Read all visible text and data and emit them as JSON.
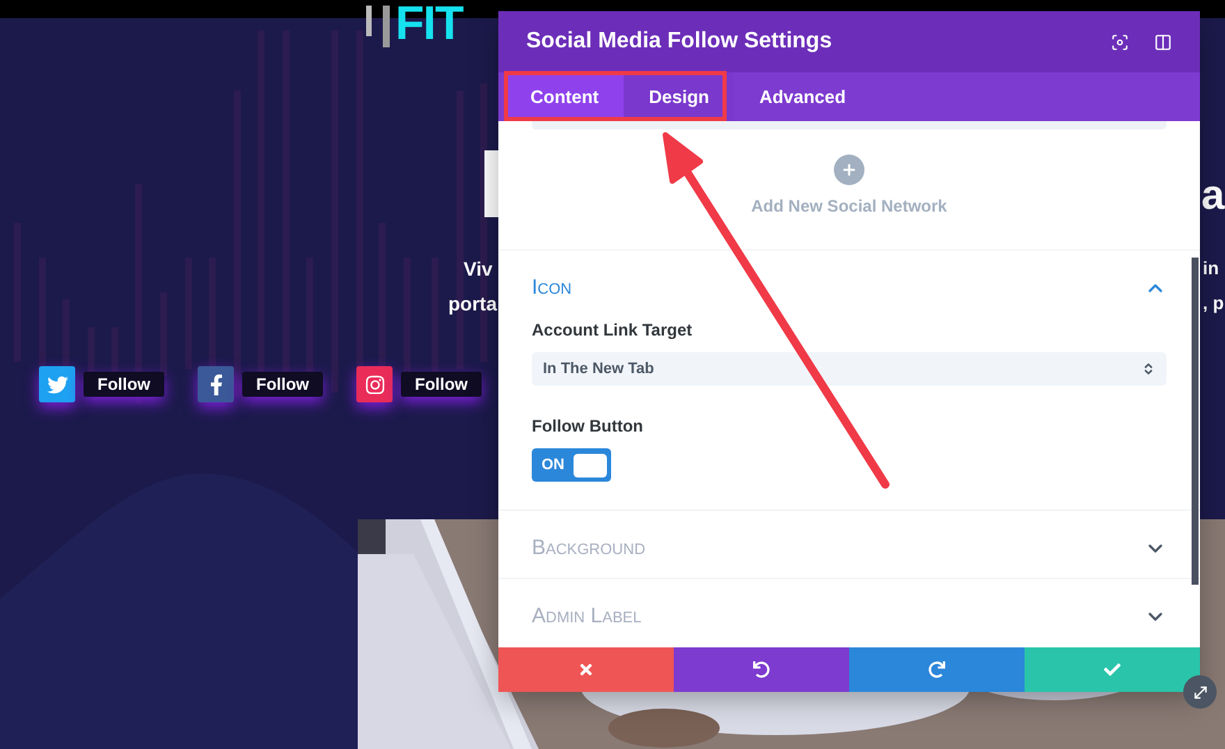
{
  "background_page": {
    "logo": "FIT",
    "heading_fragment": "a",
    "text_lines": [
      {
        "left": "Viv",
        "right": "in"
      },
      {
        "left": "porta",
        "right": ", p"
      }
    ],
    "social_buttons": [
      {
        "kind": "twitter",
        "color": "#1ea1f1",
        "label": "Follow"
      },
      {
        "kind": "facebook",
        "color": "#3b5998",
        "label": "Follow"
      },
      {
        "kind": "instagram",
        "color": "#ea2c59",
        "label": "Follow"
      }
    ]
  },
  "modal": {
    "title": "Social Media Follow Settings",
    "tabs": [
      {
        "label": "Content",
        "selected": true
      },
      {
        "label": "Design",
        "selected": false
      },
      {
        "label": "Advanced",
        "selected": false
      }
    ],
    "add_network": {
      "label": "Add New Social Network"
    },
    "sections": [
      {
        "title": "Icon",
        "expanded": true,
        "fields": [
          {
            "kind": "select",
            "label": "Account Link Target",
            "value": "In The New Tab"
          },
          {
            "kind": "toggle",
            "label": "Follow Button",
            "on": true,
            "state_label": "ON"
          }
        ]
      },
      {
        "title": "Background",
        "expanded": false
      },
      {
        "title": "Admin Label",
        "expanded": false
      }
    ],
    "footer_buttons": [
      {
        "kind": "cancel",
        "color": "#ef5555"
      },
      {
        "kind": "undo",
        "color": "#7d3bcf"
      },
      {
        "kind": "redo",
        "color": "#2b87da"
      },
      {
        "kind": "save",
        "color": "#29c4a9"
      }
    ]
  }
}
